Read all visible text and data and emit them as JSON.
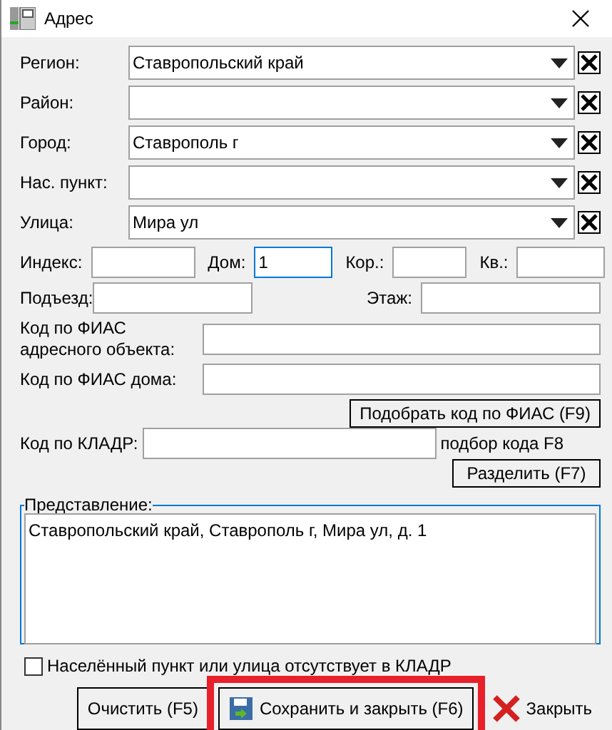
{
  "window": {
    "title": "Адрес"
  },
  "combos": [
    {
      "label": "Регион:",
      "value": "Ставропольский край"
    },
    {
      "label": "Район:"
    },
    {
      "label": "Город:",
      "value": "Ставрополь г"
    },
    {
      "label": "Нас. пункт:"
    },
    {
      "label": "Улица:",
      "value": "Мира ул"
    }
  ],
  "house_row": [
    {
      "label": "Индекс:",
      "focused": false
    },
    {
      "label": "Дом:",
      "value": "1",
      "focused": true
    },
    {
      "label": "Кор.:",
      "focused": false
    },
    {
      "label": "Кв.:",
      "focused": false
    }
  ],
  "entrance": {
    "label": "Подъезд:"
  },
  "floor": {
    "label": "Этаж:"
  },
  "fias_object": {
    "label": "Код по ФИАС адресного объекта:"
  },
  "fias_house": {
    "label": "Код по ФИАС дома:"
  },
  "fias_button": "Подобрать код по ФИАС (F9)",
  "kladr": {
    "label": "Код по КЛАДР:",
    "hint": "подбор кода F8"
  },
  "split_button": "Разделить (F7)",
  "representation": {
    "legend": "Представление:",
    "value": "Ставропольский край, Ставрополь г, Мира ул, д. 1"
  },
  "missing_checkbox": {
    "label": "Населённый пункт или улица отсутствует в КЛАДР",
    "checked": false
  },
  "buttons": [
    {
      "kind": "plain",
      "label": "Очистить (F5)",
      "highlighted": false
    },
    {
      "kind": "save",
      "label": "Сохранить и закрыть (F6)",
      "highlighted": true
    },
    {
      "kind": "close",
      "label": "Закрыть",
      "highlighted": false
    }
  ]
}
